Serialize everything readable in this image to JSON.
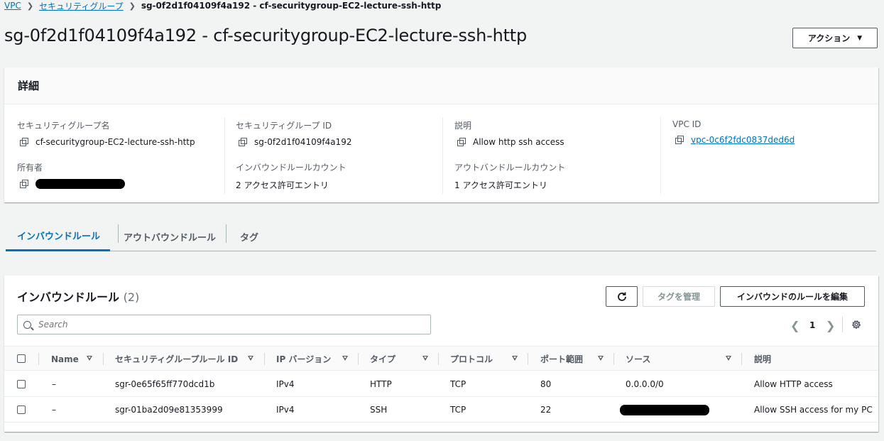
{
  "breadcrumb": {
    "vpc": "VPC",
    "security_groups": "セキュリティグループ",
    "current": "sg-0f2d1f04109f4a192 - cf-securitygroup-EC2-lecture-ssh-http"
  },
  "page_title": "sg-0f2d1f04109f4a192 - cf-securitygroup-EC2-lecture-ssh-http",
  "actions_button": "アクション",
  "details": {
    "header": "詳細",
    "sg_name_label": "セキュリティグループ名",
    "sg_name_value": "cf-securitygroup-EC2-lecture-ssh-http",
    "sg_id_label": "セキュリティグループ ID",
    "sg_id_value": "sg-0f2d1f04109f4a192",
    "description_label": "説明",
    "description_value": "Allow http ssh access",
    "vpc_id_label": "VPC ID",
    "vpc_id_value": "vpc-0c6f2fdc0837ded6d",
    "owner_label": "所有者",
    "inbound_count_label": "インバウンドルールカウント",
    "inbound_count_value": "2 アクセス許可エントリ",
    "outbound_count_label": "アウトバンドルールカウント",
    "outbound_count_value": "1 アクセス許可エントリ"
  },
  "tabs": [
    {
      "label": "インバウンドルール"
    },
    {
      "label": "アウトバウンドルール"
    },
    {
      "label": "タグ"
    }
  ],
  "rules": {
    "title": "インバウンドルール",
    "count": "(2)",
    "manage_tags_button": "タグを管理",
    "edit_rules_button": "インバウンドのルールを編集",
    "search_placeholder": "Search",
    "page_number": "1",
    "columns": [
      "Name",
      "セキュリティグループルール ID",
      "IP バージョン",
      "タイプ",
      "プロトコル",
      "ポート範囲",
      "ソース",
      "説明"
    ],
    "rows": [
      {
        "name": "–",
        "rule_id": "sgr-0e65f65ff770dcd1b",
        "ip_version": "IPv4",
        "type": "HTTP",
        "protocol": "TCP",
        "port": "80",
        "source": "0.0.0.0/0",
        "description": "Allow HTTP access"
      },
      {
        "name": "–",
        "rule_id": "sgr-01ba2d09e81353999",
        "ip_version": "IPv4",
        "type": "SSH",
        "protocol": "TCP",
        "port": "22",
        "source": "",
        "description": "Allow SSH access for my PC"
      }
    ]
  },
  "colors": {
    "link": "#0073bb",
    "text": "#16191f",
    "muted": "#545b64",
    "background": "#f2f3f3"
  }
}
